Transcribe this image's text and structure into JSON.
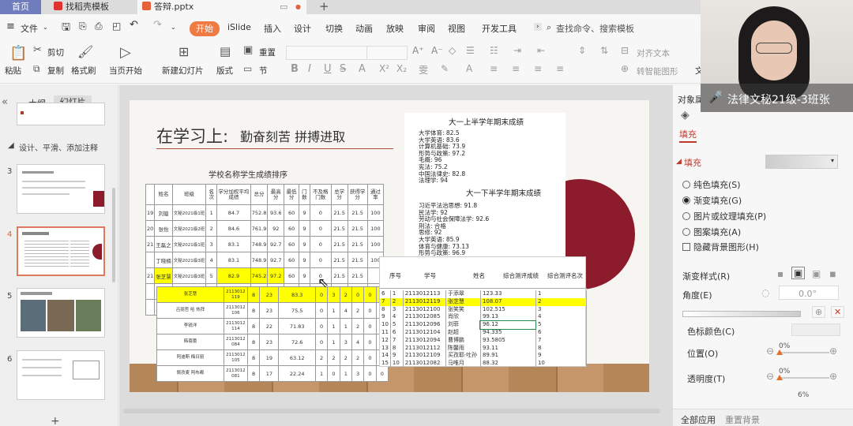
{
  "tabs": {
    "home": "首页",
    "template": "找稻壳模板",
    "doc": "答辩.pptx"
  },
  "menu": {
    "file": "文件",
    "start": "开始",
    "items": [
      "iSlide",
      "插入",
      "设计",
      "切换",
      "动画",
      "放映",
      "审阅",
      "视图",
      "开发工具"
    ],
    "search": "查找命令、搜索模板"
  },
  "toolbar": {
    "paste": "粘贴",
    "cut": "剪切",
    "copy": "复制",
    "format_painter": "格式刷",
    "from_start": "当页开始",
    "new_slide": "新建幻灯片",
    "layout": "版式",
    "section": "节",
    "reset": "重置",
    "align_text": "对齐文本",
    "smart": "转智能图形",
    "more": "文"
  },
  "left_panel": {
    "tab_outline": "大纲",
    "tab_slides": "幻灯片",
    "section_label": "设计、平滑、添加注释",
    "slide_numbers": [
      "3",
      "4",
      "5",
      "6"
    ]
  },
  "slide": {
    "title": "在学习上:",
    "subtitle": "勤奋刻苦 拼搏进取",
    "table_title": "学校名称学生成绩排序",
    "table_headers": [
      "姓名",
      "班级",
      "名次",
      "学分加权平均成绩",
      "总分",
      "最高分",
      "最低分",
      "门数",
      "不及格门数",
      "总学分",
      "获得学分",
      "通过率"
    ],
    "table_rows": [
      {
        "no": "19",
        "cells": [
          "刘璇",
          "文秘2021级1班",
          "1",
          "84.7",
          "752.8",
          "93.6",
          "60",
          "9",
          "0",
          "21.5",
          "21.5",
          "100"
        ]
      },
      {
        "no": "20",
        "cells": [
          "张怡",
          "文秘2021级2班",
          "2",
          "84.6",
          "761.9",
          "92",
          "60",
          "9",
          "0",
          "21.5",
          "21.5",
          "100"
        ]
      },
      {
        "no": "21",
        "cells": [
          "王磊之",
          "文秘2021级1班",
          "3",
          "83.1",
          "748.9",
          "92.7",
          "60",
          "9",
          "0",
          "21.5",
          "21.5",
          "100"
        ]
      },
      {
        "no": "",
        "cells": [
          "丁晓楠",
          "文秘2021级3班",
          "4",
          "83.1",
          "748.9",
          "92.7",
          "60",
          "9",
          "0",
          "21.5",
          "21.5",
          "100"
        ]
      },
      {
        "no": "21",
        "cells": [
          "张芝慧",
          "文秘2021级3班",
          "5",
          "82.9",
          "745.2",
          "97.2",
          "60",
          "9",
          "0",
          "21.5",
          "21.5",
          ""
        ]
      },
      {
        "no": "",
        "cells": [
          "刘莎",
          "文秘2021级3班",
          "6",
          "82.8",
          "744.9",
          "93.1",
          "60",
          "9",
          "0",
          "21.5",
          "21.5",
          ""
        ]
      },
      {
        "no": "",
        "cells": [
          "王煦博",
          "文秘2021级1班",
          "7",
          "82.8",
          "731.7",
          "95.8",
          "60",
          "9",
          "0",
          "21.5",
          "21.5",
          ""
        ]
      }
    ],
    "lower_rows": [
      {
        "name": "张芝慧",
        "id": "2113012119",
        "c": [
          "8",
          "23",
          "83.3",
          "0",
          "3",
          "2",
          "0",
          "0",
          "0"
        ]
      },
      {
        "name": "吕丽哲 哈 热拜",
        "id": "2113012106",
        "c": [
          "8",
          "23",
          "75.5",
          "0",
          "1",
          "4",
          "2",
          "0",
          "0"
        ]
      },
      {
        "name": "李锐洋",
        "id": "2113012114",
        "c": [
          "8",
          "22",
          "71.83",
          "0",
          "1",
          "1",
          "2",
          "0",
          "0"
        ]
      },
      {
        "name": "韩蓓蕾",
        "id": "2113012084",
        "c": [
          "8",
          "23",
          "72.6",
          "0",
          "1",
          "3",
          "4",
          "0",
          "0"
        ]
      },
      {
        "name": "阿迪斯 梅日丽",
        "id": "2113012105",
        "c": [
          "8",
          "19",
          "63.12",
          "2",
          "2",
          "2",
          "2",
          "0",
          "0"
        ]
      },
      {
        "name": "佩孜麦 阿布都",
        "id": "2113012081",
        "c": [
          "8",
          "17",
          "22.24",
          "1",
          "0",
          "1",
          "3",
          "0",
          "0"
        ]
      }
    ],
    "grades1_title": "大一上半学年期末成绩",
    "grades1": [
      "大学体育: 82.5",
      "大学英语: 83.6",
      "计算机基础: 73.9",
      "形势与政策: 97.2",
      "毛概: 96",
      "宪法: 75.2",
      "中国法律史: 82.8",
      "法理学: 94"
    ],
    "grades2_title": "大一下半学年期末成绩",
    "grades2": [
      "习近平法治思想: 91.8",
      "民法学: 92",
      "劳动与社会保障法学: 92.6",
      "刑法: 合格",
      "思修: 92",
      "大学英语: 85.9",
      "体育与健康: 73.13",
      "形势与政策: 96.9",
      "大学生心理健康: 93.5"
    ],
    "rank_headers": [
      "序号",
      "学号",
      "姓名",
      "综合测评成绩",
      "综合测评名次"
    ],
    "rank_rows": [
      {
        "r": "6",
        "no": "1",
        "id": "2113012113",
        "name": "于添翠",
        "score": "123.33",
        "rank": "1"
      },
      {
        "r": "7",
        "no": "2",
        "id": "2113012119",
        "name": "张芝慧",
        "score": "108.07",
        "rank": "2"
      },
      {
        "r": "8",
        "no": "3",
        "id": "2113012100",
        "name": "张笑笑",
        "score": "102.515",
        "rank": "3"
      },
      {
        "r": "9",
        "no": "4",
        "id": "2113012085",
        "name": "肖欣",
        "score": "99.13",
        "rank": "4"
      },
      {
        "r": "10",
        "no": "5",
        "id": "2113012096",
        "name": "刘菲",
        "score": "96.12",
        "rank": "5"
      },
      {
        "r": "11",
        "no": "6",
        "id": "2113012104",
        "name": "赵超",
        "score": "94.335",
        "rank": "6"
      },
      {
        "r": "12",
        "no": "7",
        "id": "2113012094",
        "name": "曹博鹏",
        "score": "93.5805",
        "rank": "7"
      },
      {
        "r": "13",
        "no": "8",
        "id": "2113012112",
        "name": "陈馨雨",
        "score": "93.11",
        "rank": "8"
      },
      {
        "r": "14",
        "no": "9",
        "id": "2113012109",
        "name": "买孜耶·吐孙",
        "score": "89.91",
        "rank": "9"
      },
      {
        "r": "15",
        "no": "10",
        "id": "2113012082",
        "name": "马唯月",
        "score": "88.32",
        "rank": "10"
      }
    ]
  },
  "right_panel": {
    "header": "对象属",
    "tab_fill": "填充",
    "section_fill": "填充",
    "options": [
      {
        "label": "纯色填充(S)",
        "on": false
      },
      {
        "label": "渐变填充(G)",
        "on": true
      },
      {
        "label": "图片或纹理填充(P)",
        "on": false
      },
      {
        "label": "图案填充(A)",
        "on": false
      }
    ],
    "hide_bg": "隐藏背景图形(H)",
    "gradient_style": "渐变样式(R)",
    "angle": "角度(E)",
    "angle_value": "0.0°",
    "stop_color": "色标颜色(C)",
    "position": "位置(O)",
    "position_value": "0%",
    "transparency": "透明度(T)",
    "transparency_value": "0%",
    "brightness_value": "6%",
    "apply_all": "全部应用",
    "reset_bg": "重置背景"
  },
  "video": {
    "caption": "法律文秘21级-3班张"
  },
  "colors": {
    "accent": "#f07a43",
    "highlight": "#ffff00",
    "slide_red": "#8c1c2c",
    "fill_red": "#c0392b"
  }
}
